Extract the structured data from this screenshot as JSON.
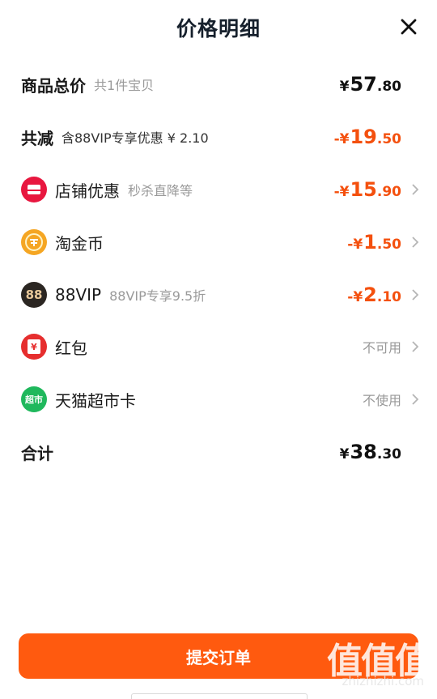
{
  "header": {
    "title": "价格明细"
  },
  "subtotal": {
    "label": "商品总价",
    "note": "共1件宝贝",
    "yen": "¥",
    "int": "57",
    "dec": ".80"
  },
  "reduction": {
    "label": "共减",
    "note": "含88VIP专享优惠 ¥ 2.10",
    "yen": "-¥",
    "int": "19",
    "dec": ".50"
  },
  "items": [
    {
      "label": "店铺优惠",
      "note": "秒杀直降等",
      "yen": "-¥",
      "int": "15",
      "dec": ".90",
      "icon": "store-icon",
      "color": "#e8173f"
    },
    {
      "label": "淘金币",
      "note": "",
      "yen": "-¥",
      "int": "1",
      "dec": ".50",
      "icon": "taojinbi-coin-icon",
      "color": "#f5a623"
    },
    {
      "label": "88VIP",
      "note": "88VIP专享9.5折",
      "yen": "-¥",
      "int": "2",
      "dec": ".10",
      "icon": "88vip-icon",
      "icon_text": "88",
      "color": "#2b2622"
    },
    {
      "label": "红包",
      "status": "不可用",
      "icon": "red-packet-icon",
      "icon_text": "¥",
      "color": "#e62e2e"
    },
    {
      "label": "天猫超市卡",
      "status": "不使用",
      "icon": "tmall-supermarket-card-icon",
      "icon_text": "超市",
      "color": "#1fb85c"
    }
  ],
  "total": {
    "label": "合计",
    "yen": "¥",
    "int": "38",
    "dec": ".30"
  },
  "submit": {
    "label": "提交订单"
  },
  "watermark": {
    "logo": "值值值",
    "url": "zhizhizhi.com"
  },
  "colors": {
    "accent": "#ff5a0f",
    "discount": "#f4500e"
  }
}
